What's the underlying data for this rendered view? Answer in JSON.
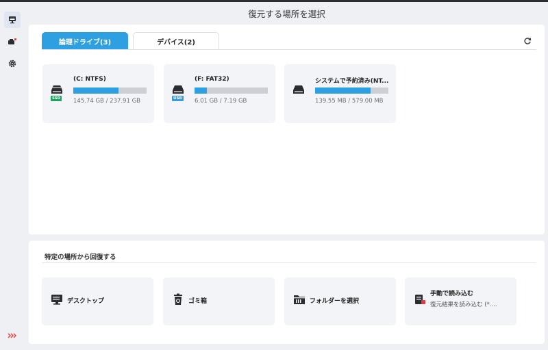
{
  "window": {
    "title": "復元する場所を選択"
  },
  "sidebar": {
    "items": [
      {
        "name": "computer-icon",
        "active": true
      },
      {
        "name": "devices-icon",
        "active": false
      },
      {
        "name": "settings-icon",
        "active": false
      }
    ],
    "expand_icon": "chevrons-right-icon"
  },
  "tabs": [
    {
      "label": "論理ドライブ(3)",
      "active": true
    },
    {
      "label": "デバイス(2)",
      "active": false
    }
  ],
  "drives": [
    {
      "name": "(C: NTFS)",
      "size": "145.74 GB / 237.91 GB",
      "used_fraction": 0.6126,
      "badge": "SSD",
      "badge_color": "#1aa260"
    },
    {
      "name": "(F: FAT32)",
      "size": "6.01 GB / 7.19 GB",
      "used_fraction": 0.1642,
      "badge": "USB",
      "badge_color": "#2e9fe0"
    },
    {
      "name": "システムで予約済み(NT...",
      "size": "139.55 MB / 579.00 MB",
      "used_fraction": 0.7591,
      "badge": "",
      "badge_color": ""
    }
  ],
  "locations": {
    "title": "特定の場所から回復する",
    "items": [
      {
        "label": "デスクトップ",
        "sub": ""
      },
      {
        "label": "ゴミ箱",
        "sub": ""
      },
      {
        "label": "フォルダーを選択",
        "sub": ""
      },
      {
        "label": "手動で読み込む",
        "sub": "復元結果を読み込む (*...."
      }
    ]
  },
  "colors": {
    "accent": "#2e9fe0",
    "bar_track": "#cdcfd4",
    "notify_dot": "#e23c3c"
  }
}
